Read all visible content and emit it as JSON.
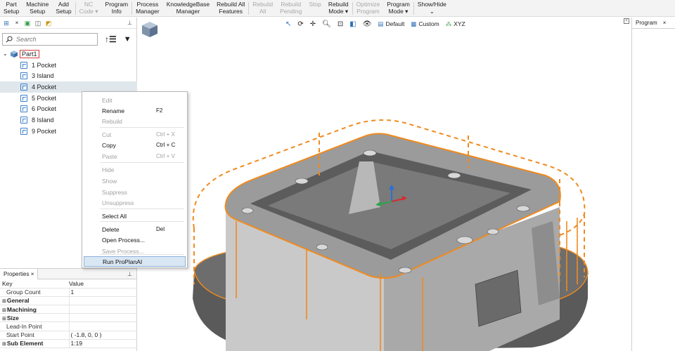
{
  "ribbon": {
    "items": [
      {
        "l1": "Part",
        "l2": "Setup",
        "dis": false
      },
      {
        "l1": "Machine",
        "l2": "Setup",
        "dis": false
      },
      {
        "l1": "Add",
        "l2": "Setup",
        "dis": false
      },
      {
        "l1": "NC",
        "l2": "Code ▾",
        "dis": true
      },
      {
        "l1": "Program",
        "l2": "Info",
        "dis": false
      },
      {
        "l1": "Process",
        "l2": "Manager",
        "dis": false
      },
      {
        "l1": "KnowledgeBase",
        "l2": "Manager",
        "dis": false
      },
      {
        "l1": "Rebuild All",
        "l2": "Features",
        "dis": false
      },
      {
        "l1": "Rebuild",
        "l2": "All",
        "dis": true
      },
      {
        "l1": "Rebuild",
        "l2": "Pending",
        "dis": true
      },
      {
        "l1": "Stop",
        "l2": "",
        "dis": true
      },
      {
        "l1": "Rebuild",
        "l2": "Mode ▾",
        "dis": false
      },
      {
        "l1": "Optimize",
        "l2": "Program",
        "dis": true
      },
      {
        "l1": "Program",
        "l2": "Mode ▾",
        "dis": false
      },
      {
        "l1": "Show/Hide",
        "l2": "⌄",
        "dis": false
      }
    ]
  },
  "tree_panel": {
    "search_placeholder": "Search",
    "root": "Part1",
    "children": [
      "1 Pocket",
      "3 Island",
      "4 Pocket",
      "5 Pocket",
      "6 Pocket",
      "8 Island",
      "9 Pocket"
    ],
    "selected_index": 2
  },
  "properties": {
    "tab": "Properties",
    "header_key": "Key",
    "header_value": "Value",
    "rows": [
      {
        "key": "Group Count",
        "value": "1",
        "kind": "leaf"
      },
      {
        "key": "General",
        "value": "",
        "kind": "group"
      },
      {
        "key": "Machining",
        "value": "",
        "kind": "group"
      },
      {
        "key": "Size",
        "value": "",
        "kind": "group"
      },
      {
        "key": "Lead-In Point",
        "value": "",
        "kind": "leaf"
      },
      {
        "key": "Start Point",
        "value": "( -1.8, 0, 0 )",
        "kind": "leaf"
      },
      {
        "key": "Sub Element",
        "value": "1:19",
        "kind": "group"
      }
    ]
  },
  "viewport_toolbar": {
    "default_label": "Default",
    "custom_label": "Custom",
    "xyz_label": "XYZ"
  },
  "program_panel": {
    "tab": "Program"
  },
  "context_menu": {
    "items": [
      {
        "label": "Edit",
        "shortcut": "",
        "enabled": false
      },
      {
        "label": "Rename",
        "shortcut": "F2",
        "enabled": true
      },
      {
        "label": "Rebuild",
        "shortcut": "",
        "enabled": false
      },
      {
        "label": "Cut",
        "shortcut": "Ctrl + X",
        "enabled": false
      },
      {
        "label": "Copy",
        "shortcut": "Ctrl + C",
        "enabled": true
      },
      {
        "label": "Paste",
        "shortcut": "Ctrl + V",
        "enabled": false
      },
      {
        "label": "Hide",
        "shortcut": "",
        "enabled": false
      },
      {
        "label": "Show",
        "shortcut": "",
        "enabled": false
      },
      {
        "label": "Suppress",
        "shortcut": "",
        "enabled": false
      },
      {
        "label": "Unsuppress",
        "shortcut": "",
        "enabled": false
      },
      {
        "label": "Select All",
        "shortcut": "",
        "enabled": true
      },
      {
        "label": "Delete",
        "shortcut": "Del",
        "enabled": true
      },
      {
        "label": "Open Process...",
        "shortcut": "",
        "enabled": true
      },
      {
        "label": "Save Process...",
        "shortcut": "",
        "enabled": false
      },
      {
        "label": "Run ProPlanAI",
        "shortcut": "",
        "enabled": true
      }
    ],
    "highlighted_index": 14
  },
  "colors": {
    "accent_orange": "#f08a1e",
    "selection_bg": "#dfe7ec",
    "menu_highlight": "#d9e6f3",
    "part_gray": "#8f8f8f"
  }
}
